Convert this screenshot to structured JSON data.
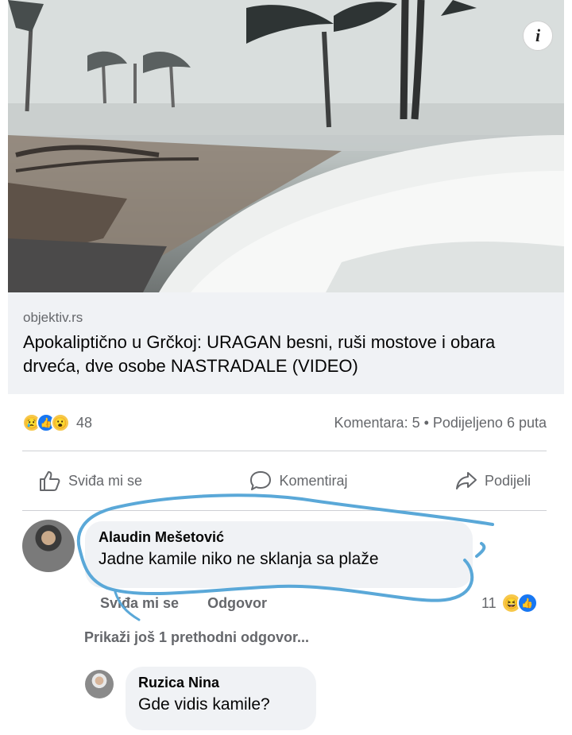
{
  "link": {
    "domain": "objektiv.rs",
    "title": "Apokaliptično u Grčkoj: URAGAN besni, ruši mostove i obara drveća, dve osobe NASTRADALE (VIDEO)",
    "info_icon": "i"
  },
  "stats": {
    "reaction_count": "48",
    "comments_shares": "Komentara: 5 • Podijeljeno 6 puta",
    "reactions": [
      "sad",
      "like",
      "wow"
    ]
  },
  "actions": {
    "like": "Sviđa mi se",
    "comment": "Komentiraj",
    "share": "Podijeli"
  },
  "comment1": {
    "author": "Alaudin Mešetović",
    "text": "Jadne kamile niko ne sklanja sa plaže",
    "like_label": "Sviđa mi se",
    "reply_label": "Odgovor",
    "reaction_count": "11",
    "reactions": [
      "haha",
      "like"
    ]
  },
  "more_replies": "Prikaži još 1 prethodni odgovor...",
  "comment2": {
    "author": "Ruzica Nina",
    "text": "Gde vidis kamile?"
  },
  "colors": {
    "scribble": "#5aa8d8",
    "like_blue": "#1877f2",
    "muted_text": "#65676b",
    "bubble_bg": "#f0f2f5"
  }
}
